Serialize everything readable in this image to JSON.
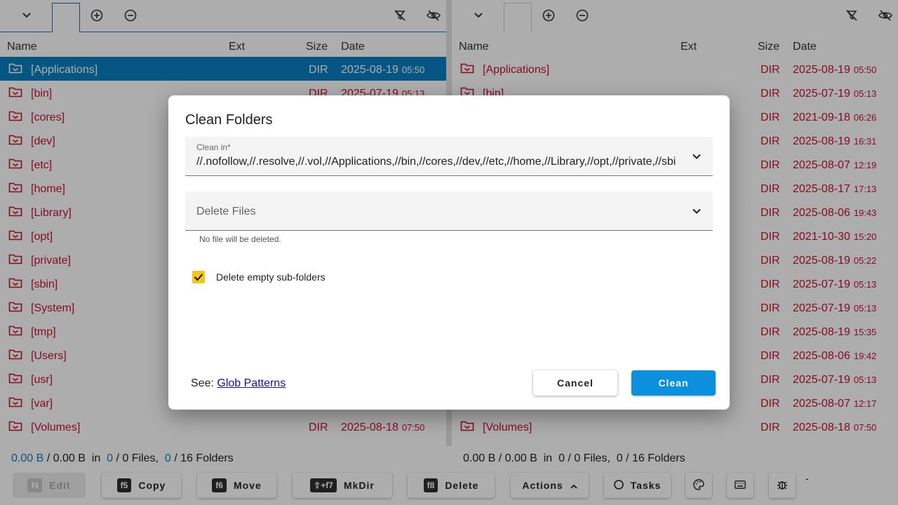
{
  "left_pane": {
    "columns": {
      "name": "Name",
      "ext": "Ext",
      "size": "Size",
      "date": "Date"
    },
    "rows": [
      {
        "name": "[Applications]",
        "size": "DIR",
        "date": "2025-08-19",
        "time": "05:50",
        "selected": true
      },
      {
        "name": "[bin]",
        "size": "DIR",
        "date": "2025-07-19",
        "time": "05:13"
      },
      {
        "name": "[cores]"
      },
      {
        "name": "[dev]"
      },
      {
        "name": "[etc]"
      },
      {
        "name": "[home]"
      },
      {
        "name": "[Library]"
      },
      {
        "name": "[opt]"
      },
      {
        "name": "[private]"
      },
      {
        "name": "[sbin]"
      },
      {
        "name": "[System]"
      },
      {
        "name": "[tmp]"
      },
      {
        "name": "[Users]"
      },
      {
        "name": "[usr]"
      },
      {
        "name": "[var]"
      },
      {
        "name": "[Volumes]",
        "size": "DIR",
        "date": "2025-08-18",
        "time": "07:50"
      }
    ]
  },
  "right_pane": {
    "columns": {
      "name": "Name",
      "ext": "Ext",
      "size": "Size",
      "date": "Date"
    },
    "rows": [
      {
        "name": "[Applications]",
        "size": "DIR",
        "date": "2025-08-19",
        "time": "05:50"
      },
      {
        "name": "[bin]",
        "size": "DIR",
        "date": "2025-07-19",
        "time": "05:13"
      },
      {
        "name": "",
        "size": "DIR",
        "date": "2021-09-18",
        "time": "06:26"
      },
      {
        "name": "",
        "size": "DIR",
        "date": "2025-08-19",
        "time": "16:31"
      },
      {
        "name": "",
        "size": "DIR",
        "date": "2025-08-07",
        "time": "12:19"
      },
      {
        "name": "",
        "size": "DIR",
        "date": "2025-08-17",
        "time": "17:13"
      },
      {
        "name": "",
        "size": "DIR",
        "date": "2025-08-06",
        "time": "19:43"
      },
      {
        "name": "",
        "size": "DIR",
        "date": "2021-10-30",
        "time": "15:20"
      },
      {
        "name": "",
        "size": "DIR",
        "date": "2025-08-19",
        "time": "05:22"
      },
      {
        "name": "",
        "size": "DIR",
        "date": "2025-07-19",
        "time": "05:13"
      },
      {
        "name": "",
        "size": "DIR",
        "date": "2025-07-19",
        "time": "05:13"
      },
      {
        "name": "",
        "size": "DIR",
        "date": "2025-08-19",
        "time": "15:35"
      },
      {
        "name": "",
        "size": "DIR",
        "date": "2025-08-06",
        "time": "19:42"
      },
      {
        "name": "",
        "size": "DIR",
        "date": "2025-07-19",
        "time": "05:13"
      },
      {
        "name": "",
        "size": "DIR",
        "date": "2025-08-07",
        "time": "12:17"
      },
      {
        "name": "[Volumes]",
        "size": "DIR",
        "date": "2025-08-18",
        "time": "07:50"
      }
    ]
  },
  "status_left": {
    "sel_size": "0.00 B",
    "total_size": "/ 0.00 B",
    "in": "in",
    "sel_files": "0",
    "files_rest": "/ 0 Files,",
    "sel_folders": "0",
    "folders_rest": "/ 16 Folders"
  },
  "status_right": {
    "text": "0.00 B / 0.00 B  in  0 / 0 Files,  0 / 16 Folders"
  },
  "toolbar": {
    "edit": {
      "key": "f4",
      "label": "Edit"
    },
    "copy": {
      "key": "f5",
      "label": "Copy"
    },
    "move": {
      "key": "f6",
      "label": "Move"
    },
    "mkdir": {
      "key": "⇧+f7",
      "label": "MkDir"
    },
    "delete": {
      "key": "f8",
      "label": "Delete"
    },
    "actions": {
      "label": "Actions"
    },
    "tasks": {
      "label": "Tasks"
    },
    "extra": "-"
  },
  "dialog": {
    "title": "Clean Folders",
    "clean_in_label": "Clean in*",
    "clean_in_value": "//.nofollow,//.resolve,//.vol,//Applications,//bin,//cores,//dev,//etc,//home,//Library,//opt,//private,//sbin,//System,//tmp,//Users,//usr,//var,//Volumes",
    "delete_files_placeholder": "Delete Files",
    "hint": "No file will be deleted.",
    "checkbox_label": "Delete empty sub-folders",
    "checkbox_checked": true,
    "see_label": "See:",
    "see_link": "Glob Patterns",
    "cancel_label": "Cancel",
    "clean_label": "Clean"
  },
  "colors": {
    "accent": "#0a7fc2",
    "dir_text": "#c4122f",
    "checkbox": "#f5c518",
    "primary_button": "#0a90dc"
  }
}
